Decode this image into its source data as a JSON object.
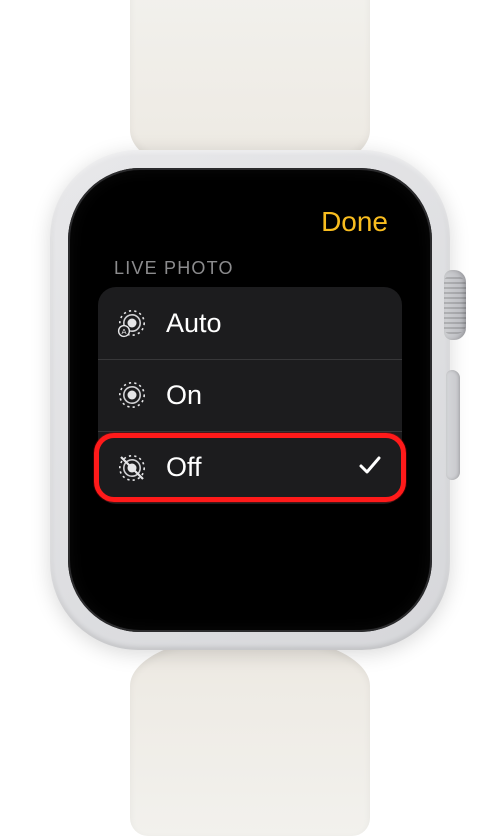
{
  "header": {
    "done_label": "Done",
    "done_color": "#f9bd1f"
  },
  "section": {
    "label": "LIVE PHOTO"
  },
  "options": [
    {
      "id": "auto",
      "label": "Auto",
      "icon": "live-photo-auto-icon",
      "selected": false
    },
    {
      "id": "on",
      "label": "On",
      "icon": "live-photo-on-icon",
      "selected": false
    },
    {
      "id": "off",
      "label": "Off",
      "icon": "live-photo-off-icon",
      "selected": true,
      "highlighted": true
    }
  ]
}
